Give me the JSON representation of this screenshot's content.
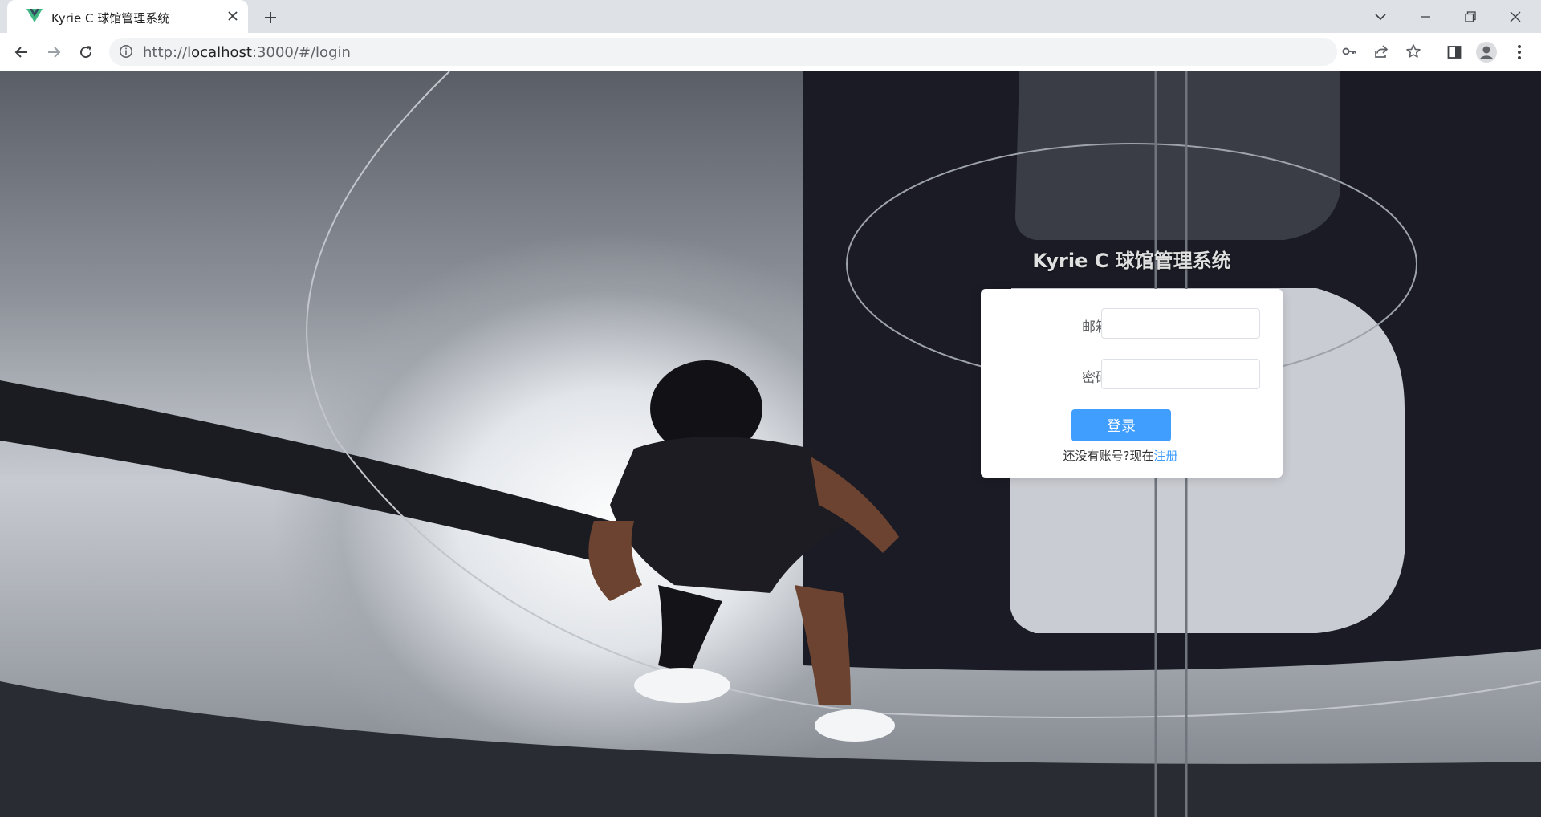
{
  "browser": {
    "tab": {
      "title": "Kyrie C 球馆管理系统",
      "favicon": "vue-logo-icon"
    },
    "url": {
      "scheme": "http://",
      "host": "localhost",
      "path": ":3000/#/login"
    },
    "icons": {
      "back": "arrow-left-icon",
      "forward": "arrow-right-icon",
      "reload": "reload-icon",
      "info": "info-icon",
      "key": "key-icon",
      "share": "share-icon",
      "bookmark": "star-icon",
      "sidepanel": "side-panel-icon",
      "profile": "profile-icon",
      "menu": "kebab-menu-icon"
    }
  },
  "login": {
    "title": "Kyrie C 球馆管理系统",
    "email_label": "邮箱",
    "email_value": "",
    "password_label": "密码",
    "password_value": "",
    "submit_label": "登录",
    "register_prompt": "还没有账号?现在",
    "register_link": "注册"
  },
  "colors": {
    "primary": "#409eff",
    "card": "#ffffff",
    "title": "#e0e0e0"
  }
}
